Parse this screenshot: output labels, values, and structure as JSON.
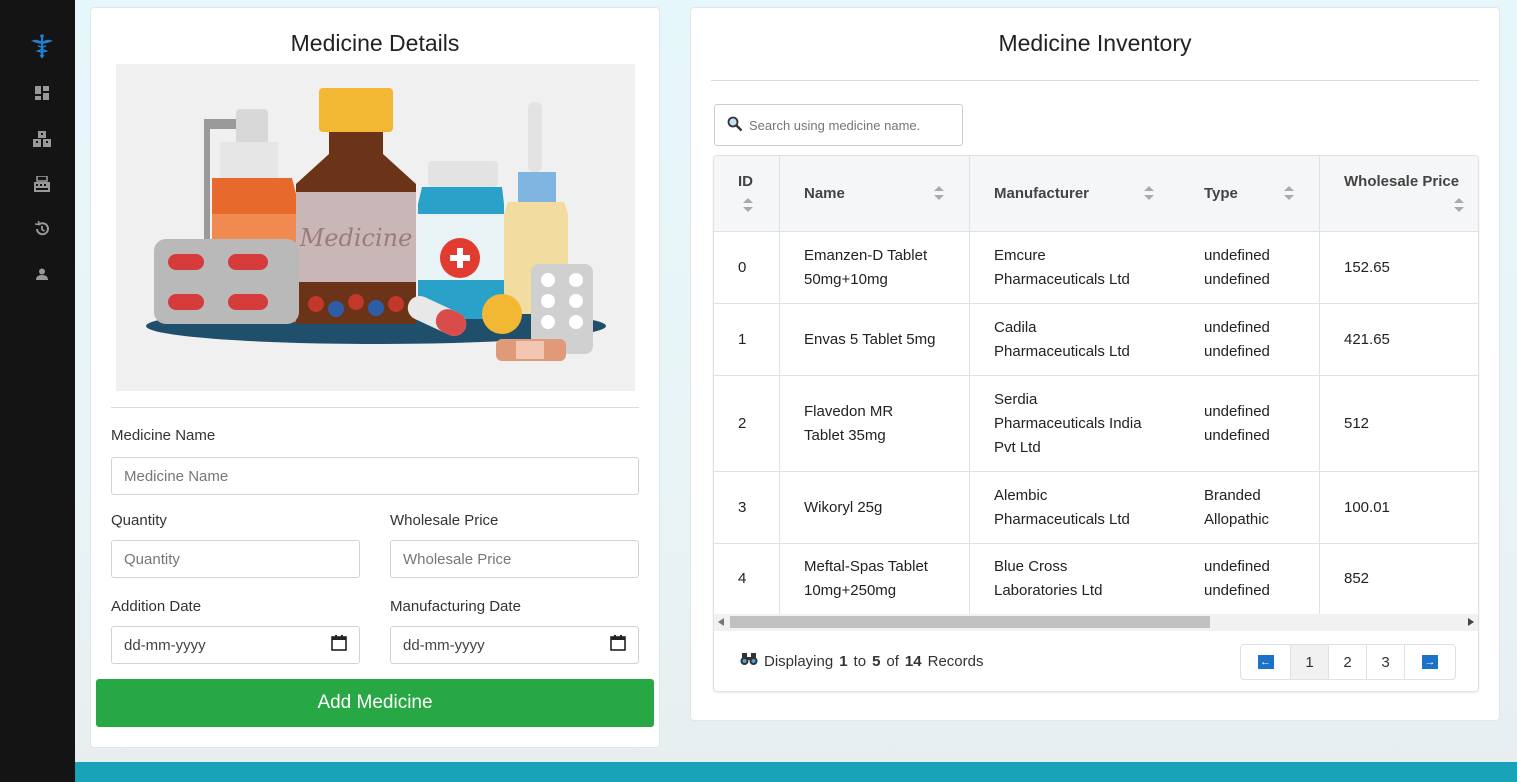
{
  "sidebar": {
    "icons": [
      "caduceus-logo-icon",
      "dashboard-icon",
      "inventory-icon",
      "billing-icon",
      "history-icon",
      "user-icon"
    ]
  },
  "colors": {
    "accent": "#28a745",
    "bottom_bar": "#17a2b8",
    "pager_arrow": "#1a73c9"
  },
  "details": {
    "title": "Medicine Details",
    "image_caption": "Medicine",
    "medicine_name_label": "Medicine Name",
    "medicine_name_placeholder": "Medicine Name",
    "quantity_label": "Quantity",
    "quantity_placeholder": "Quantity",
    "wholesale_label": "Wholesale Price",
    "wholesale_placeholder": "Wholesale Price",
    "addition_date_label": "Addition Date",
    "addition_date_value": "dd-mm-yyyy",
    "manufacturing_date_label": "Manufacturing Date",
    "manufacturing_date_value": "dd-mm-yyyy",
    "add_button": "Add Medicine"
  },
  "inventory": {
    "title": "Medicine Inventory",
    "search_placeholder": "Search using medicine name.",
    "columns": [
      "ID",
      "Name",
      "Manufacturer",
      "Type",
      "Wholesale Price"
    ],
    "rows": [
      {
        "id": "0",
        "name_1": "Emanzen-D Tablet",
        "name_2": "50mg+10mg",
        "man_1": "Emcure",
        "man_2": "Pharmaceuticals Ltd",
        "man_3": "",
        "type_1": "undefined",
        "type_2": "undefined",
        "price": "152.65"
      },
      {
        "id": "1",
        "name_1": "Envas 5 Tablet 5mg",
        "name_2": "",
        "man_1": "Cadila",
        "man_2": "Pharmaceuticals Ltd",
        "man_3": "",
        "type_1": "undefined",
        "type_2": "undefined",
        "price": "421.65"
      },
      {
        "id": "2",
        "name_1": "Flavedon MR",
        "name_2": "Tablet 35mg",
        "man_1": "Serdia",
        "man_2": "Pharmaceuticals India",
        "man_3": "Pvt Ltd",
        "type_1": "undefined",
        "type_2": "undefined",
        "price": "512"
      },
      {
        "id": "3",
        "name_1": "Wikoryl 25g",
        "name_2": "",
        "man_1": "Alembic",
        "man_2": "Pharmaceuticals Ltd",
        "man_3": "",
        "type_1": "Branded",
        "type_2": "Allopathic",
        "price": "100.01"
      },
      {
        "id": "4",
        "name_1": "Meftal-Spas Tablet",
        "name_2": "10mg+250mg",
        "man_1": "Blue Cross",
        "man_2": "Laboratories Ltd",
        "man_3": "",
        "type_1": "undefined",
        "type_2": "undefined",
        "price": "852"
      }
    ],
    "footer": {
      "prefix": "Displaying",
      "from": "1",
      "to_word": "to",
      "to": "5",
      "of_word": "of",
      "total": "14",
      "suffix": "Records"
    },
    "pages": [
      "1",
      "2",
      "3"
    ],
    "prev_arrow": "←",
    "next_arrow": "→"
  }
}
